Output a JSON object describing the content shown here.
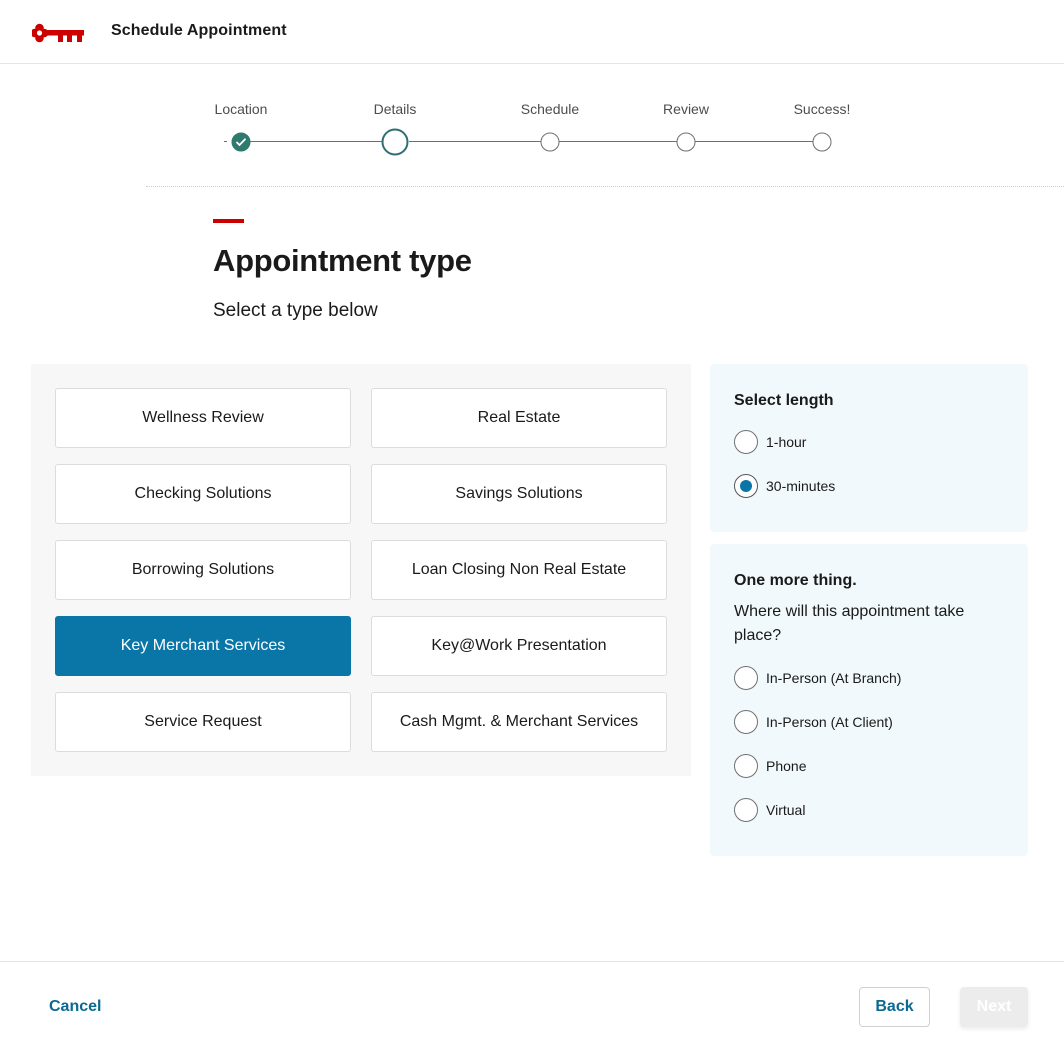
{
  "header": {
    "logo_icon": "key-logo-icon",
    "title": "Schedule Appointment"
  },
  "stepper": {
    "steps": [
      {
        "label": "Location",
        "state": "complete"
      },
      {
        "label": "Details",
        "state": "current"
      },
      {
        "label": "Schedule",
        "state": "upcoming"
      },
      {
        "label": "Review",
        "state": "upcoming"
      },
      {
        "label": "Success!",
        "state": "upcoming"
      }
    ]
  },
  "main": {
    "title": "Appointment type",
    "subtitle": "Select a type below",
    "types": [
      {
        "label": "Wellness Review",
        "selected": false
      },
      {
        "label": "Real Estate",
        "selected": false
      },
      {
        "label": "Checking Solutions",
        "selected": false
      },
      {
        "label": "Savings Solutions",
        "selected": false
      },
      {
        "label": "Borrowing Solutions",
        "selected": false
      },
      {
        "label": "Loan Closing Non Real Estate",
        "selected": false
      },
      {
        "label": "Key Merchant Services",
        "selected": true
      },
      {
        "label": "Key@Work Presentation",
        "selected": false
      },
      {
        "label": "Service Request",
        "selected": false
      },
      {
        "label": "Cash Mgmt. & Merchant Services",
        "selected": false
      }
    ]
  },
  "length_panel": {
    "heading": "Select length",
    "options": [
      {
        "label": "1-hour",
        "checked": false
      },
      {
        "label": "30-minutes",
        "checked": true
      }
    ]
  },
  "location_panel": {
    "heading": "One more thing.",
    "question": "Where will this appointment take place?",
    "options": [
      {
        "label": "In-Person (At Branch)",
        "checked": false
      },
      {
        "label": "In-Person (At Client)",
        "checked": false
      },
      {
        "label": "Phone",
        "checked": false
      },
      {
        "label": "Virtual",
        "checked": false
      }
    ]
  },
  "footer": {
    "cancel_label": "Cancel",
    "back_label": "Back",
    "next_label": "Next"
  },
  "colors": {
    "brand_red": "#cc0000",
    "accent_blue": "#0a75a7",
    "step_green": "#2e7a6f",
    "panel_blue": "#f1f9fd"
  }
}
